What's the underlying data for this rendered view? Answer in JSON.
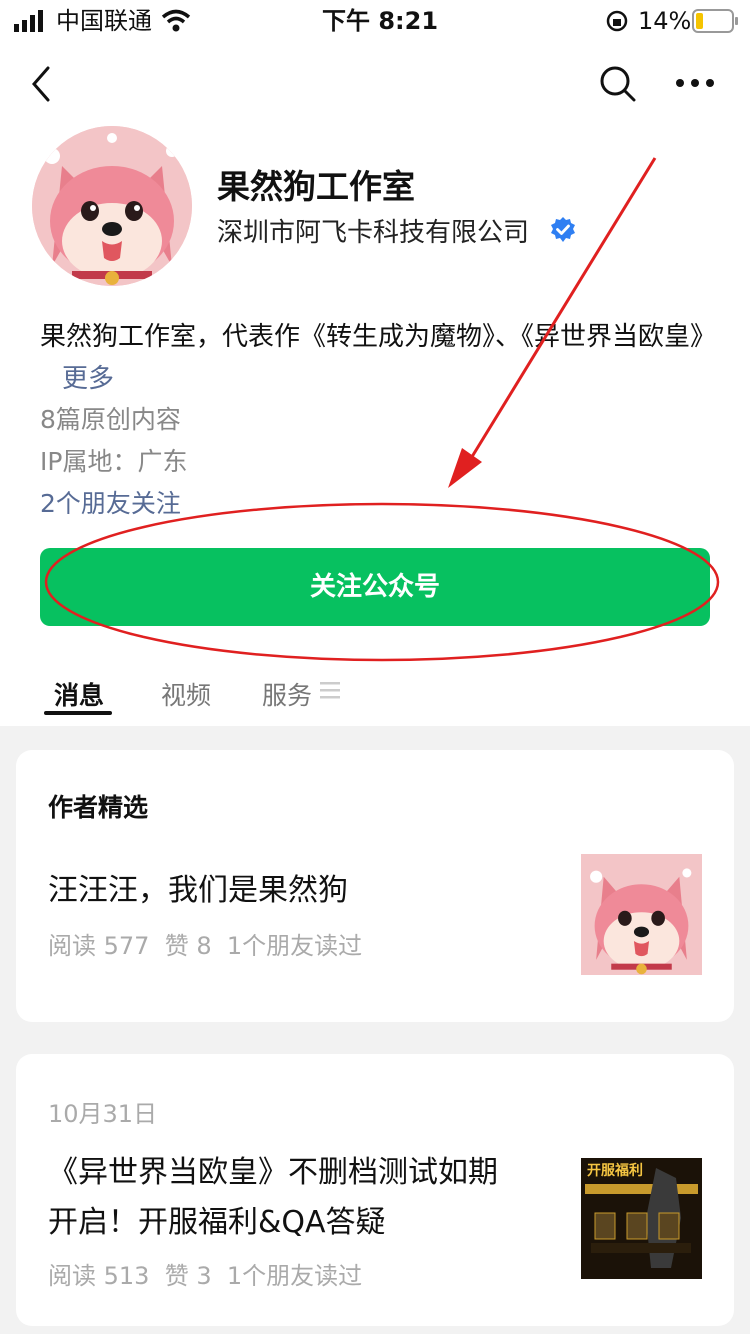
{
  "status_bar": {
    "carrier": "中国联通",
    "time": "下午 8:21",
    "battery": "14%"
  },
  "nav": {
    "back_icon": "chevron-left-icon",
    "search_icon": "search-icon",
    "more_icon": "more-dots-icon"
  },
  "profile": {
    "name": "果然狗工作室",
    "company": "深圳市阿飞卡科技有限公司",
    "description": "果然狗工作室，代表作《转生成为魔物》、《异世界当欧皇》",
    "more_label": "更多",
    "original_count": "8篇原创内容",
    "ip_location": "IP属地：广东",
    "friends_following": "2个朋友关注",
    "follow_button": "关注公众号"
  },
  "tabs": [
    {
      "label": "消息",
      "active": true
    },
    {
      "label": "视频",
      "active": false
    },
    {
      "label": "服务",
      "active": false
    }
  ],
  "featured": {
    "heading": "作者精选",
    "article": {
      "title": "汪汪汪，我们是果然狗",
      "meta": "阅读 577  赞 8  1个朋友读过"
    }
  },
  "post": {
    "date": "10月31日",
    "title_line1": "《异世界当欧皇》不删档测试如期",
    "title_line2": "开启！开服福利&QA答疑",
    "meta": "阅读 513  赞 3  1个朋友读过",
    "thumb_text": "开服福利"
  },
  "colors": {
    "accent_green": "#07c160",
    "link_blue": "#576b95",
    "annotation_red": "#e02020"
  }
}
